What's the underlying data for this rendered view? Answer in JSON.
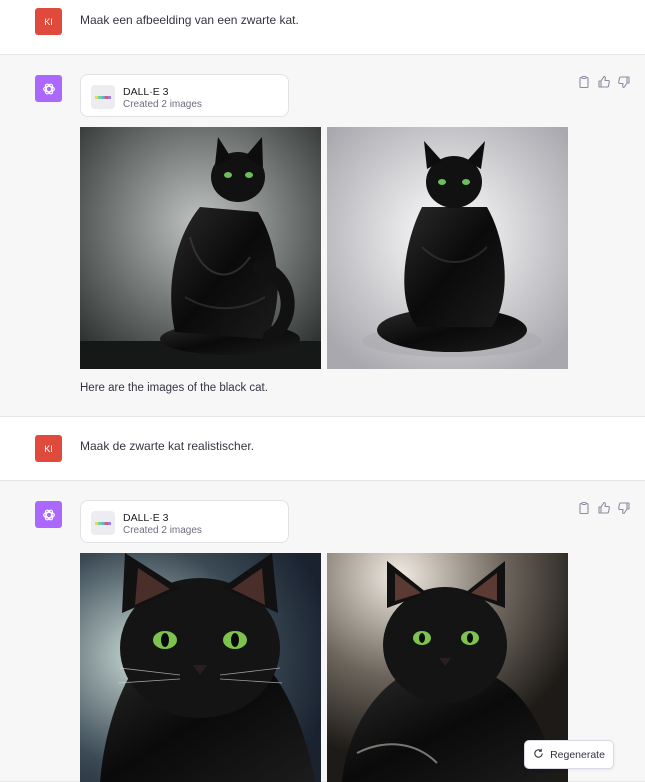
{
  "messages": [
    {
      "role": "user",
      "initials": "KI",
      "text": "Maak een afbeelding van een zwarte kat."
    },
    {
      "role": "assistant",
      "tool_title": "DALL·E 3",
      "tool_status": "Created 2 images",
      "caption": "Here are the images of the black cat."
    },
    {
      "role": "user",
      "initials": "KI",
      "text": "Maak de zwarte kat realistischer."
    },
    {
      "role": "assistant",
      "tool_title": "DALL·E 3",
      "tool_status": "Created 2 images"
    }
  ],
  "regenerate_label": "Regenerate",
  "icons": {
    "copy": "clipboard-icon",
    "thumbs_up": "thumbs-up-icon",
    "thumbs_down": "thumbs-down-icon",
    "regenerate": "refresh-icon",
    "assistant_logo": "openai-logo-icon"
  },
  "colors": {
    "user_avatar": "#e04a3c",
    "assistant_avatar": "#ab68ff",
    "assistant_bg": "#f7f7f8"
  }
}
